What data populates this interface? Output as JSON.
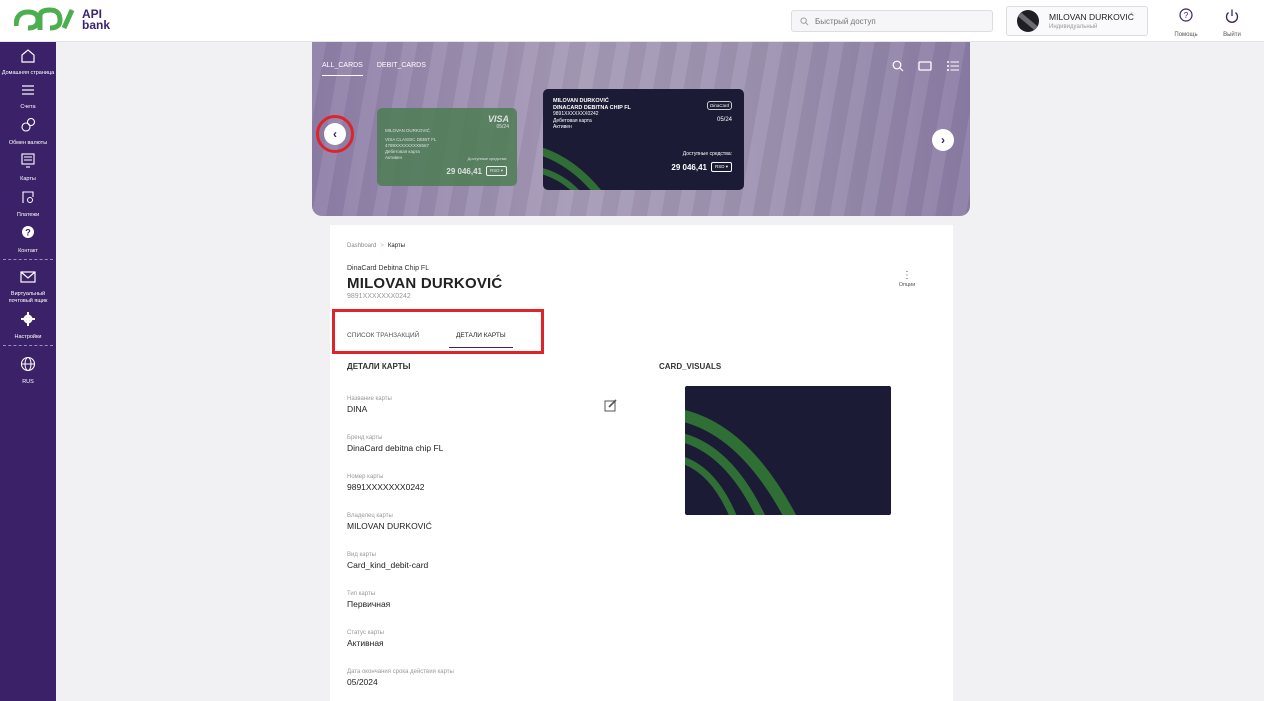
{
  "brand": {
    "logo_text_line1": "API",
    "logo_text_line2": "bank",
    "accent": "#3b2268",
    "highlight": "#e0232a"
  },
  "search": {
    "placeholder": "Быстрый доступ"
  },
  "user": {
    "name": "MILOVAN DURKOVIĆ",
    "role": "Индивидуальный"
  },
  "top_actions": {
    "help": "Помощь",
    "logout": "Выйти"
  },
  "sidebar": {
    "items": [
      {
        "label": "Домашняя страница",
        "icon": "home-icon"
      },
      {
        "label": "Счета",
        "icon": "list-icon"
      },
      {
        "label": "Обмен валюты",
        "icon": "exchange-icon"
      },
      {
        "label": "Карты",
        "icon": "cards-icon"
      },
      {
        "label": "Платежи",
        "icon": "payments-icon"
      },
      {
        "label": "Контакт",
        "icon": "contact-icon"
      },
      {
        "label": "Виртуальный почтовый ящик",
        "icon": "mail-icon"
      },
      {
        "label": "Настройки",
        "icon": "gear-icon"
      },
      {
        "label": "RUS",
        "icon": "globe-icon"
      }
    ]
  },
  "carousel": {
    "tabs": [
      "ALL_CARDS",
      "DEBIT_CARDS"
    ],
    "small_card": {
      "holder": "MILOVAN DURKOVIĆ",
      "product": "VISA CLASSIC DEBIT FL",
      "number": "4789XXXXXXXX6567",
      "kind": "Дебетовая карта",
      "status": "Активен",
      "network": "VISA",
      "expiry": "05/24",
      "available_label": "Доступные средства:",
      "balance": "29 046,41",
      "currency": "RSD"
    },
    "main_card": {
      "holder": "MILOVAN DURKOVIĆ",
      "product": "DINACARD DEBITNA CHIP FL",
      "number": "9891XXXXXXX0242",
      "kind": "Дебетовая карта",
      "status": "Активен",
      "network": "DinaCard",
      "expiry": "05/24",
      "available_label": "Доступные средства:",
      "balance": "29 046,41",
      "currency": "RSD"
    }
  },
  "page": {
    "breadcrumb": {
      "root": "Dashboard",
      "sep": ">",
      "current": "Карты"
    },
    "card_type": "DinaCard Debitna Chip FL",
    "holder": "MILOVAN DURKOVIĆ",
    "card_number": "9891XXXXXXX0242",
    "options_label": "Опции",
    "tabs": [
      "СПИСОК ТРАНЗАКЦИЙ",
      "ДЕТАЛИ КАРТЫ"
    ],
    "details_title": "ДЕТАЛИ КАРТЫ",
    "visuals_title": "CARD_VISUALS",
    "fields": [
      {
        "label": "Название карты",
        "value": "DINA"
      },
      {
        "label": "Бренд карты",
        "value": "DinaCard debitna chip FL"
      },
      {
        "label": "Номер карты",
        "value": "9891XXXXXXX0242"
      },
      {
        "label": "Владелец карты",
        "value": "MILOVAN DURKOVIĆ"
      },
      {
        "label": "Вид карты",
        "value": "Card_kind_debit-card"
      },
      {
        "label": "Тип карты",
        "value": "Первичная"
      },
      {
        "label": "Статус карты",
        "value": "Активная"
      },
      {
        "label": "Дата окончания срока действия карты",
        "value": "05/2024"
      }
    ]
  }
}
